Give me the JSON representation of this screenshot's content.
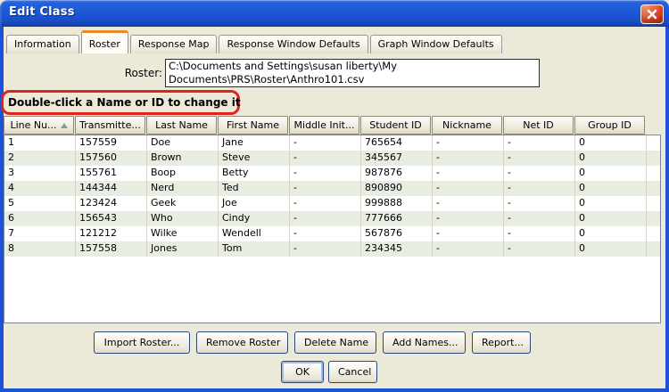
{
  "window": {
    "title": "Edit Class"
  },
  "tabs": [
    {
      "label": "Information",
      "selected": false
    },
    {
      "label": "Roster",
      "selected": true
    },
    {
      "label": "Response Map",
      "selected": false
    },
    {
      "label": "Response Window Defaults",
      "selected": false
    },
    {
      "label": "Graph Window Defaults",
      "selected": false
    }
  ],
  "roster": {
    "label": "Roster:",
    "path_line1": "C:\\Documents and Settings\\susan liberty\\My",
    "path_line2": "Documents\\PRS\\Roster\\Anthro101.csv"
  },
  "annotation": {
    "text": "Double-click a Name or ID to change it",
    "color": "#E0241B"
  },
  "table": {
    "columns": [
      "Line Nu...",
      "Transmitte...",
      "Last Name",
      "First Name",
      "Middle Init...",
      "Student ID",
      "Nickname",
      "Net ID",
      "Group ID"
    ],
    "sort_column_index": 0,
    "sort_direction": "ascending",
    "rows": [
      [
        "1",
        "157559",
        "Doe",
        "Jane",
        "-",
        "765654",
        "-",
        "-",
        "0"
      ],
      [
        "2",
        "157560",
        "Brown",
        "Steve",
        "-",
        "345567",
        "-",
        "-",
        "0"
      ],
      [
        "3",
        "155761",
        "Boop",
        "Betty",
        "-",
        "987876",
        "-",
        "-",
        "0"
      ],
      [
        "4",
        "144344",
        "Nerd",
        "Ted",
        "-",
        "890890",
        "-",
        "-",
        "0"
      ],
      [
        "5",
        "123424",
        "Geek",
        "Joe",
        "-",
        "999888",
        "-",
        "-",
        "0"
      ],
      [
        "6",
        "156543",
        "Who",
        "Cindy",
        "-",
        "777666",
        "-",
        "-",
        "0"
      ],
      [
        "7",
        "121212",
        "Wilke",
        "Wendell",
        "-",
        "567876",
        "-",
        "-",
        "0"
      ],
      [
        "8",
        "157558",
        "Jones",
        "Tom",
        "-",
        "234345",
        "-",
        "-",
        "0"
      ]
    ]
  },
  "buttons": {
    "import": "Import Roster...",
    "remove": "Remove Roster",
    "delete": "Delete Name",
    "add": "Add Names...",
    "report": "Report...",
    "ok": "OK",
    "cancel": "Cancel"
  }
}
